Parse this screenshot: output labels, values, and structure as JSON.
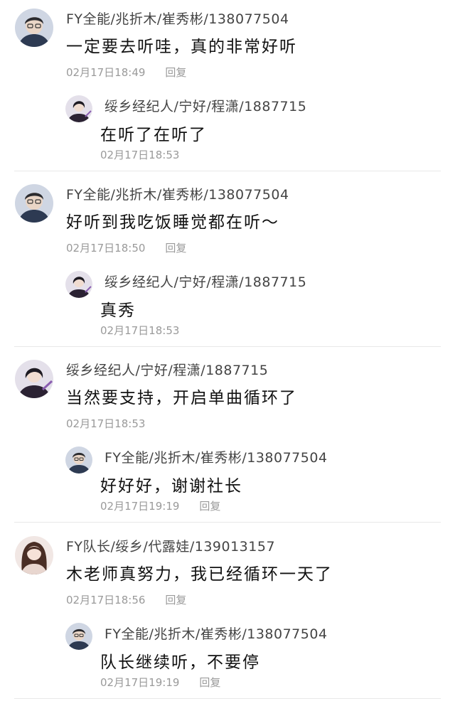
{
  "threads": [
    {
      "main": {
        "user": "FY全能/兆折木/崔秀彬/138077504",
        "text": "一定要去听哇，真的非常好听",
        "time": "02月17日18:49",
        "reply_label": "回复",
        "avatar": "avatar-man-glasses"
      },
      "reply": {
        "user": "绥乡经纪人/宁好/程潇/1887715",
        "text": "在听了在听了",
        "time": "02月17日18:53",
        "avatar": "avatar-woman-dark-costume"
      }
    },
    {
      "main": {
        "user": "FY全能/兆折木/崔秀彬/138077504",
        "text": "好听到我吃饭睡觉都在听～",
        "time": "02月17日18:50",
        "reply_label": "回复",
        "avatar": "avatar-man-glasses"
      },
      "reply": {
        "user": "绥乡经纪人/宁好/程潇/1887715",
        "text": "真秀",
        "time": "02月17日18:53",
        "avatar": "avatar-woman-dark-costume"
      }
    },
    {
      "main": {
        "user": "绥乡经纪人/宁好/程潇/1887715",
        "text": "当然要支持，开启单曲循环了",
        "time": "02月17日18:53",
        "avatar": "avatar-woman-dark-costume"
      },
      "reply": {
        "user": "FY全能/兆折木/崔秀彬/138077504",
        "text": "好好好，谢谢社长",
        "time": "02月17日19:19",
        "reply_label": "回复",
        "avatar": "avatar-man-glasses"
      }
    },
    {
      "main": {
        "user": "FY队长/绥乡/代露娃/139013157",
        "text": "木老师真努力，我已经循环一天了",
        "time": "02月17日18:56",
        "reply_label": "回复",
        "avatar": "avatar-woman-long-hair"
      },
      "reply": {
        "user": "FY全能/兆折木/崔秀彬/138077504",
        "text": "队长继续听，不要停",
        "time": "02月17日19:19",
        "reply_label": "回复",
        "avatar": "avatar-man-glasses"
      }
    }
  ],
  "colors": {
    "meta": "#9a9a9a",
    "divider": "#e8e8e8",
    "text": "#111111"
  }
}
